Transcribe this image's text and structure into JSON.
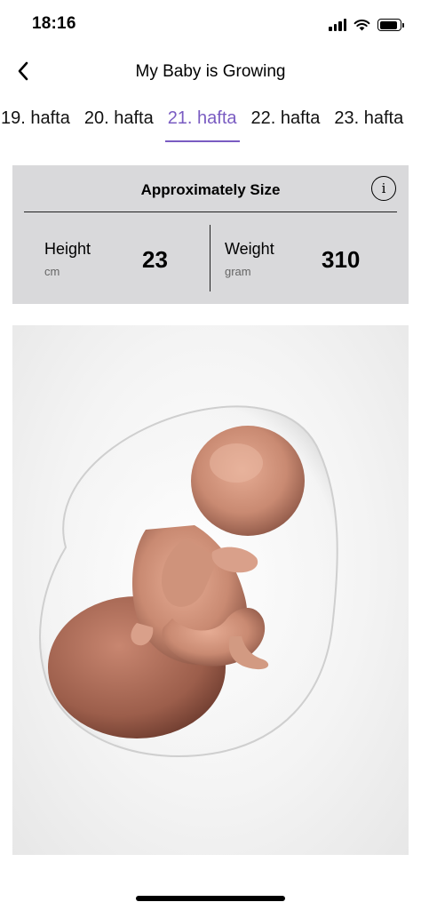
{
  "status_bar": {
    "time": "18:16"
  },
  "nav": {
    "title": "My Baby is Growing",
    "back_icon": "chevron-left-icon"
  },
  "weeks": {
    "tabs": [
      "19. hafta",
      "20. hafta",
      "21. hafta",
      "22. hafta",
      "23. hafta"
    ],
    "selected": "21. hafta",
    "accent_color": "#7a5cc2"
  },
  "size_card": {
    "title": "Approximately Size",
    "info_icon": "info-icon",
    "height": {
      "label": "Height",
      "unit": "cm",
      "value": "23"
    },
    "weight": {
      "label": "Weight",
      "unit": "gram",
      "value": "310"
    },
    "background_color": "#d9d9db"
  },
  "illustration": {
    "icon": "fetus-illustration"
  }
}
